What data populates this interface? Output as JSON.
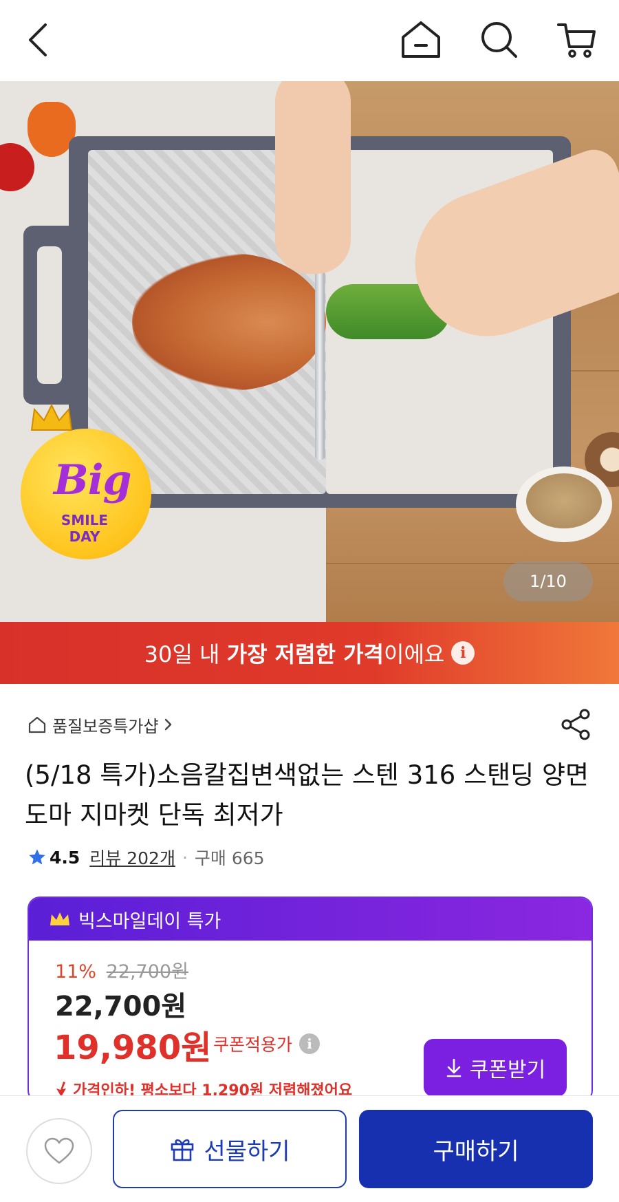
{
  "header": {
    "back_icon": "chevron-left-icon",
    "home_icon": "home-icon",
    "search_icon": "search-icon",
    "cart_icon": "cart-icon"
  },
  "hero": {
    "counter": "1/10",
    "badge_big": "Big",
    "badge_smile": "SMILE",
    "badge_day": "DAY"
  },
  "banner": {
    "prefix": "30일 내 ",
    "highlight": "가장 저렴한 가격",
    "suffix": "이에요"
  },
  "product": {
    "store_name": "품질보증특가샵",
    "title": "(5/18 특가)소음칼집변색없는 스텐 316 스탠딩 양면도마 지마켓 단독 최저가",
    "rating": "4.5",
    "review_label": "리뷰 202개",
    "purchase_label": "구매 665"
  },
  "deal": {
    "header_label": "빅스마일데이 특가",
    "discount_pct": "11%",
    "original_price": "22,700원",
    "price": "22,700원",
    "coupon_price": "19,980원",
    "coupon_applied_label": "쿠폰적용가",
    "coupon_button_label": "쿠폰받기",
    "price_drop_text": "가격인하! 평소보다 1,290원 저렴해졌어요",
    "accent_color": "#6d2ee0",
    "sale_color": "#e0302a"
  },
  "bottom_bar": {
    "gift_label": "선물하기",
    "buy_label": "구매하기",
    "buy_color": "#1630b0"
  }
}
